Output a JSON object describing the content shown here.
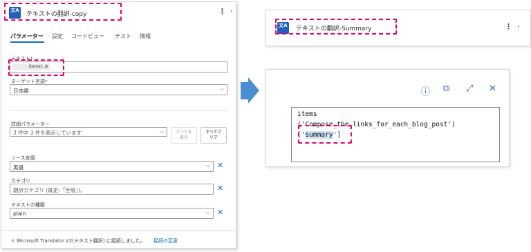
{
  "left_card": {
    "title": "テキストの翻訳-copy",
    "icon_text": "文A",
    "tabs": [
      "パラメーター",
      "設定",
      "コードビュー",
      "テスト",
      "情報"
    ],
    "text_field": {
      "label": "テキスト",
      "token": "items(...)",
      "token_close": "×"
    },
    "target_lang": {
      "label": "ターゲット言語",
      "value": "日本語"
    },
    "advanced": {
      "label": "詳細パラメーター",
      "summary": "3 件中 3 件を表示しています",
      "btn_show_all": "すべてを\n表示",
      "btn_clear_all": "すべてク\nリア"
    },
    "source_lang": {
      "label": "ソース言語",
      "value": "英語"
    },
    "category": {
      "label": "カテゴリ",
      "placeholder": "翻訳カテゴリ (既定:「全般」)。"
    },
    "text_type": {
      "label": "テキストの種類",
      "value": "plain"
    },
    "footer": {
      "connection": "Microsoft Translator V2(テキスト翻訳) に接続しました。",
      "change_link": "接続の変更"
    }
  },
  "right_top_card": {
    "title": "テキストの翻訳-Summary"
  },
  "right_bottom_card": {
    "code_lines": [
      "items",
      "('Compose_the_links_for_each_blog_post')"
    ],
    "code_line3_pre": "['",
    "code_line3_hl": "summary",
    "code_line3_post": "']"
  },
  "colors": {
    "accent": "#0f6cbd",
    "dash": "#e4006f",
    "arrow": "#4a8ed4",
    "icon_bg": "#1f5fbf"
  }
}
